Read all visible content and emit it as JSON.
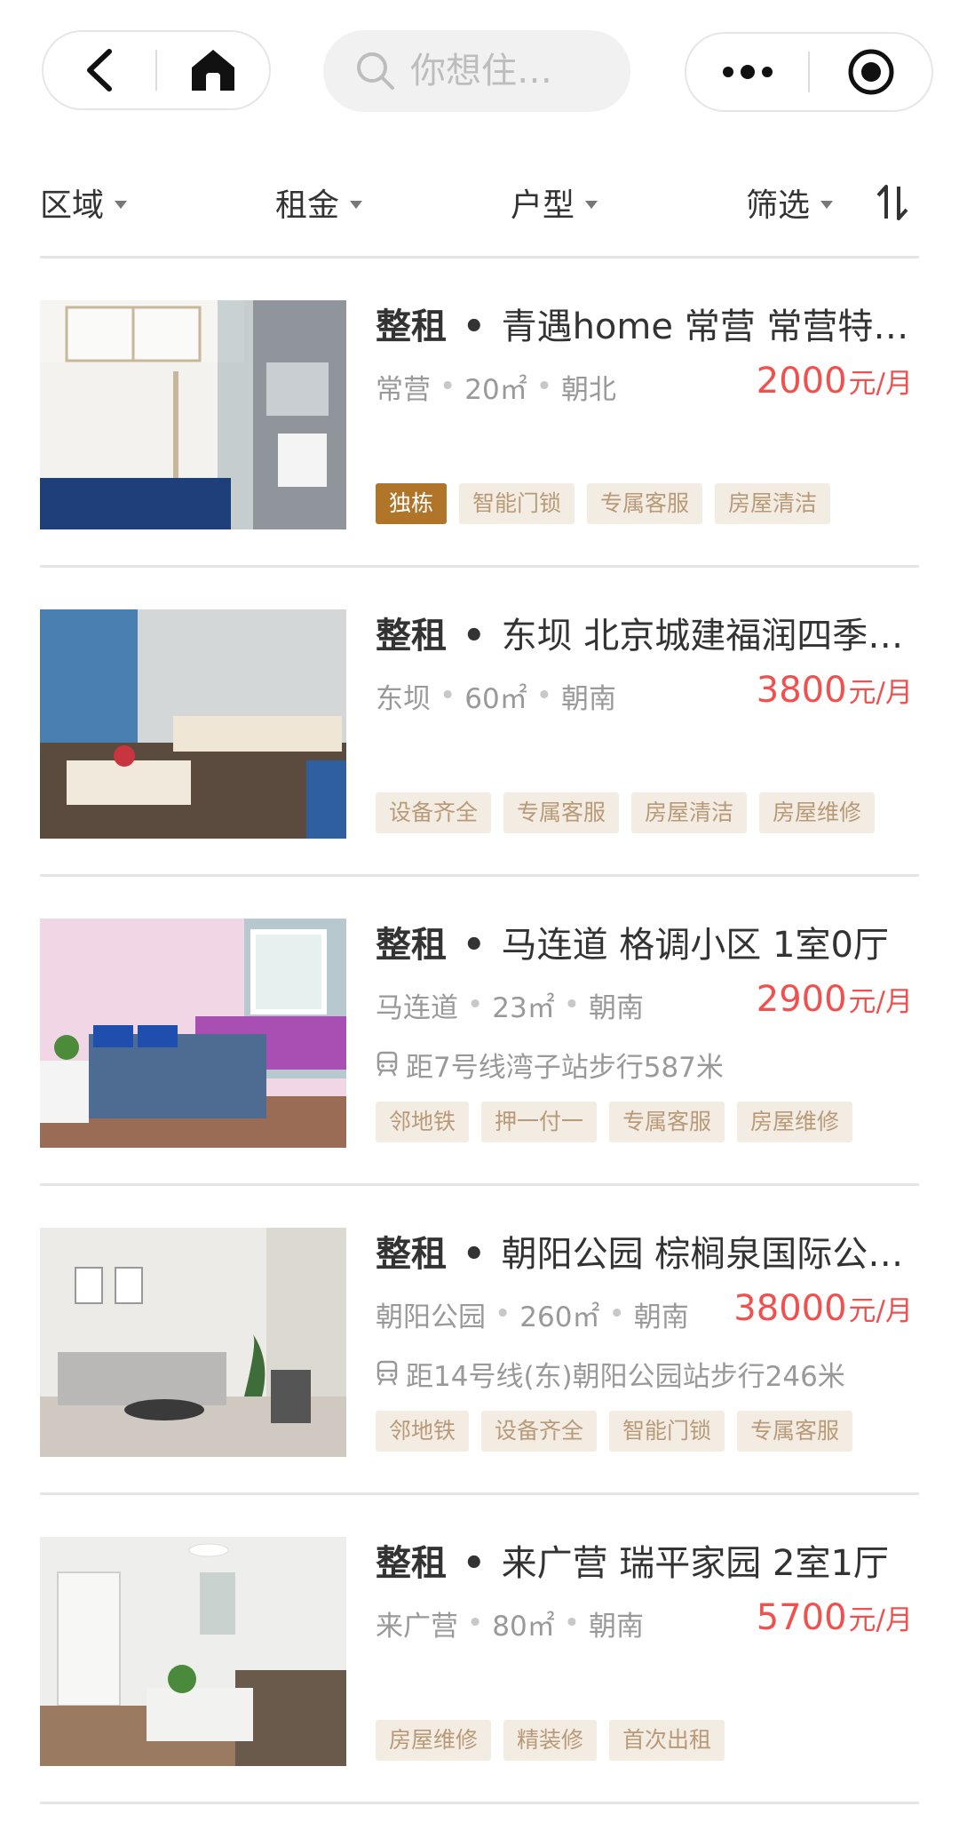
{
  "search": {
    "placeholder": "你想住…"
  },
  "filters": [
    {
      "label": "区域"
    },
    {
      "label": "租金"
    },
    {
      "label": "户型"
    },
    {
      "label": "筛选"
    }
  ],
  "listings": [
    {
      "kind": "整租",
      "title": "青遇home 常营 常营特…",
      "area_name": "常营",
      "size": "20㎡",
      "orientation": "朝北",
      "price": "2000",
      "unit": "元/月",
      "subway": "",
      "tags": [
        {
          "label": "独栋",
          "highlight": true
        },
        {
          "label": "智能门锁",
          "highlight": false
        },
        {
          "label": "专属客服",
          "highlight": false
        },
        {
          "label": "房屋清洁",
          "highlight": false
        }
      ]
    },
    {
      "kind": "整租",
      "title": "东坝 北京城建福润四季…",
      "area_name": "东坝",
      "size": "60㎡",
      "orientation": "朝南",
      "price": "3800",
      "unit": "元/月",
      "subway": "",
      "tags": [
        {
          "label": "设备齐全",
          "highlight": false
        },
        {
          "label": "专属客服",
          "highlight": false
        },
        {
          "label": "房屋清洁",
          "highlight": false
        },
        {
          "label": "房屋维修",
          "highlight": false
        }
      ]
    },
    {
      "kind": "整租",
      "title": "马连道 格调小区 1室0厅",
      "area_name": "马连道",
      "size": "23㎡",
      "orientation": "朝南",
      "price": "2900",
      "unit": "元/月",
      "subway": "距7号线湾子站步行587米",
      "tags": [
        {
          "label": "邻地铁",
          "highlight": false
        },
        {
          "label": "押一付一",
          "highlight": false
        },
        {
          "label": "专属客服",
          "highlight": false
        },
        {
          "label": "房屋维修",
          "highlight": false
        }
      ]
    },
    {
      "kind": "整租",
      "title": "朝阳公园 棕榈泉国际公…",
      "area_name": "朝阳公园",
      "size": "260㎡",
      "orientation": "朝南",
      "price": "38000",
      "unit": "元/月",
      "subway": "距14号线(东)朝阳公园站步行246米",
      "tags": [
        {
          "label": "邻地铁",
          "highlight": false
        },
        {
          "label": "设备齐全",
          "highlight": false
        },
        {
          "label": "智能门锁",
          "highlight": false
        },
        {
          "label": "专属客服",
          "highlight": false
        }
      ]
    },
    {
      "kind": "整租",
      "title": "来广营 瑞平家园 2室1厅",
      "area_name": "来广营",
      "size": "80㎡",
      "orientation": "朝南",
      "price": "5700",
      "unit": "元/月",
      "subway": "",
      "tags": [
        {
          "label": "房屋维修",
          "highlight": false
        },
        {
          "label": "精装修",
          "highlight": false
        },
        {
          "label": "首次出租",
          "highlight": false
        }
      ]
    }
  ],
  "colors": {
    "price": "#f0514f",
    "tag_bg": "#f3ece3",
    "tag_text": "#b99a78",
    "tag_highlight_bg": "#b1752a"
  }
}
